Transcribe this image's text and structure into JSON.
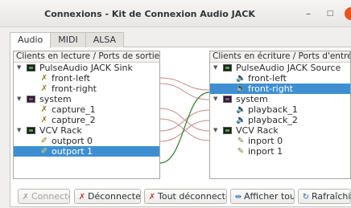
{
  "window": {
    "title": "Connexions - Kit de Connexion Audio JACK",
    "min_glyph": "–",
    "max_glyph": "□",
    "close_glyph": "×"
  },
  "tabs": [
    {
      "label": "Audio",
      "active": true
    },
    {
      "label": "MIDI",
      "active": false
    },
    {
      "label": "ALSA",
      "active": false
    }
  ],
  "left_list": {
    "header": "Clients en lecture / Ports de sortie",
    "rows": [
      {
        "label": "PulseAudio JACK Sink",
        "type": "client",
        "icon": "app-icon"
      },
      {
        "label": "front-left",
        "type": "port",
        "icon": "port-output-icon"
      },
      {
        "label": "front-right",
        "type": "port",
        "icon": "port-output-icon"
      },
      {
        "label": "system",
        "type": "client",
        "icon": "system-icon"
      },
      {
        "label": "capture_1",
        "type": "port",
        "icon": "port-output-icon"
      },
      {
        "label": "capture_2",
        "type": "port",
        "icon": "port-output-icon"
      },
      {
        "label": "VCV Rack",
        "type": "client",
        "icon": "app-icon"
      },
      {
        "label": "outport 0",
        "type": "port",
        "icon": "port-output-icon"
      },
      {
        "label": "outport 1",
        "type": "port",
        "icon": "port-output-icon",
        "selected": true
      }
    ]
  },
  "right_list": {
    "header": "Clients en écriture / Ports d'entrée",
    "rows": [
      {
        "label": "PulseAudio JACK Source",
        "type": "client",
        "icon": "app-icon"
      },
      {
        "label": "front-left",
        "type": "port",
        "icon": "speaker-icon"
      },
      {
        "label": "front-right",
        "type": "port",
        "icon": "speaker-icon",
        "selected": true
      },
      {
        "label": "system",
        "type": "client",
        "icon": "system-icon"
      },
      {
        "label": "playback_1",
        "type": "port",
        "icon": "speaker-icon"
      },
      {
        "label": "playback_2",
        "type": "port",
        "icon": "speaker-icon"
      },
      {
        "label": "VCV Rack",
        "type": "client",
        "icon": "app-icon"
      },
      {
        "label": "inport 0",
        "type": "port",
        "icon": "port-input-icon"
      },
      {
        "label": "inport 1",
        "type": "port",
        "icon": "port-input-icon"
      }
    ]
  },
  "buttons": {
    "connect": "Connecter",
    "disconnect": "Déconnecter",
    "disconnect_all": "Tout déconnecter",
    "show_all": "Afficher tout",
    "refresh": "Rafraîchir"
  },
  "colors": {
    "selection": "#3d8fd1",
    "connection_line": "#c98a8a",
    "active_connection": "#2d7d2d",
    "close_button": "#e95420"
  }
}
